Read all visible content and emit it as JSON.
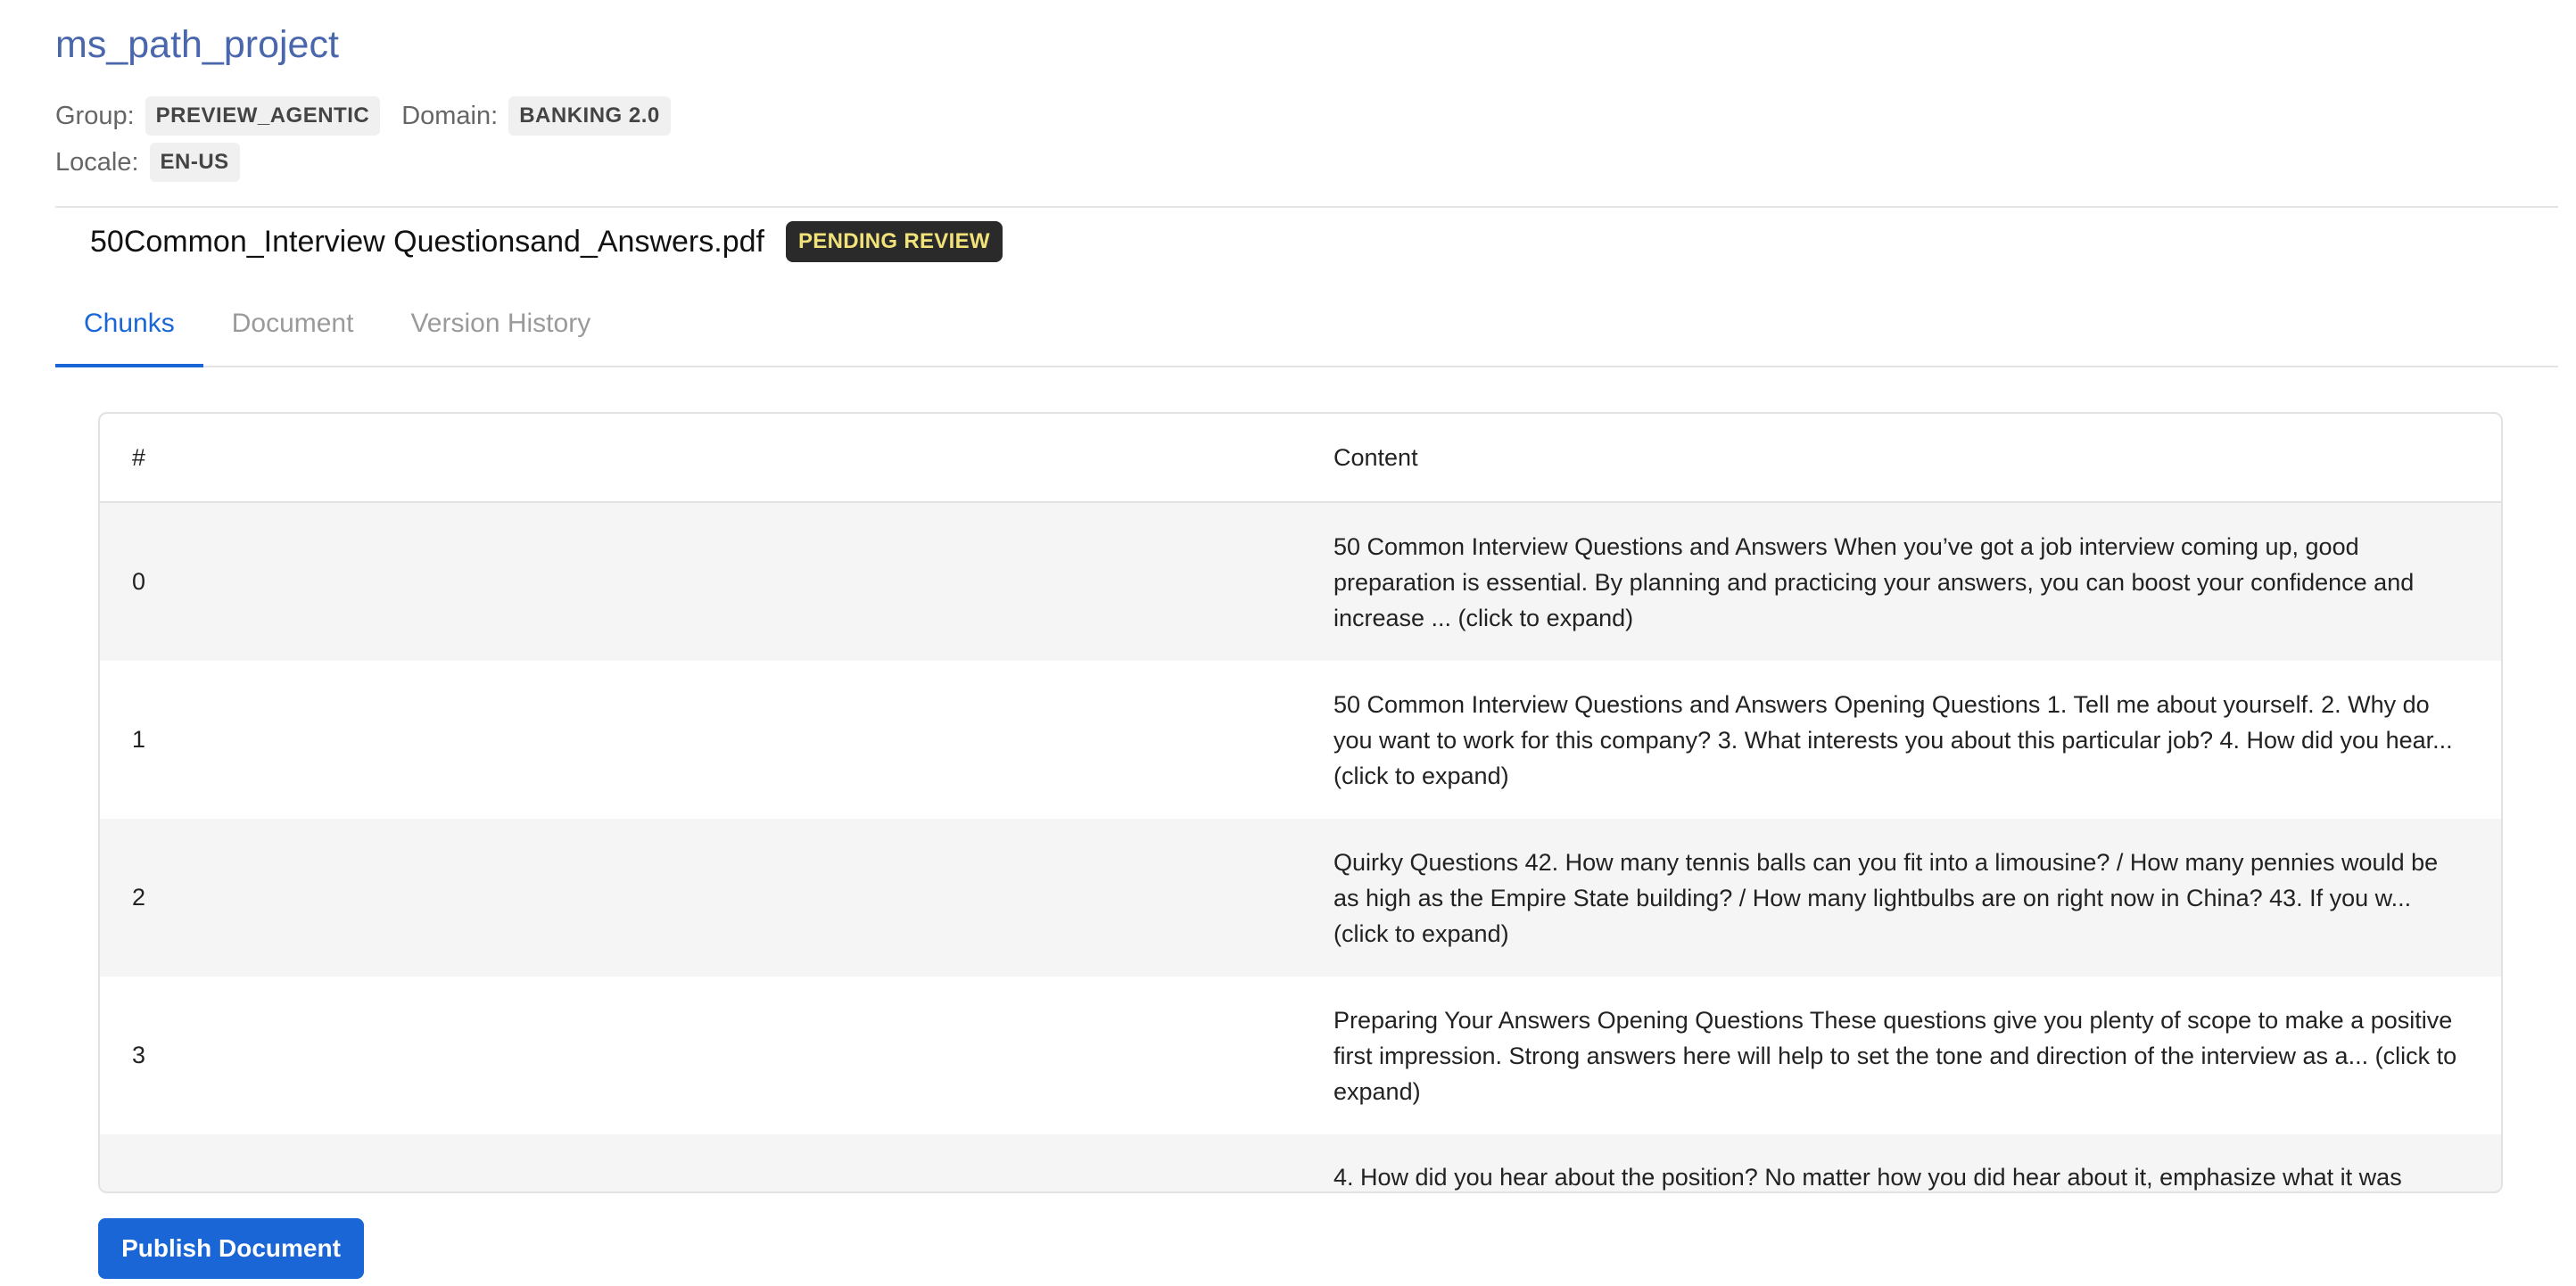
{
  "project": {
    "title": "ms_path_project"
  },
  "meta": {
    "group_label": "Group:",
    "group_value": "PREVIEW_AGENTIC",
    "domain_label": "Domain:",
    "domain_value": "BANKING 2.0",
    "locale_label": "Locale:",
    "locale_value": "EN-US"
  },
  "document": {
    "filename": "50Common_Interview Questionsand_Answers.pdf",
    "status": "PENDING REVIEW",
    "status_colors": {
      "background": "#2a2a2a",
      "text": "#f1e27a"
    }
  },
  "tabs": [
    {
      "label": "Chunks",
      "active": true
    },
    {
      "label": "Document",
      "active": false
    },
    {
      "label": "Version History",
      "active": false
    }
  ],
  "table": {
    "headers": {
      "num": "#",
      "content": "Content"
    },
    "rows": [
      {
        "num": "0",
        "content": "50 Common Interview Questions and Answers When you’ve got a job interview coming up, good preparation is essential. By planning and practicing your answers, you can boost your confidence and increase ... (click to expand)"
      },
      {
        "num": "1",
        "content": "50 Common Interview Questions and Answers Opening Questions 1. Tell me about yourself. 2. Why do you want to work for this company? 3. What interests you about this particular job? 4. How did you hear... (click to expand)"
      },
      {
        "num": "2",
        "content": "Quirky Questions 42. How many tennis balls can you fit into a limousine? / How many pennies would be as high as the Empire State building? / How many lightbulbs are on right now in China? 43. If you w... (click to expand)"
      },
      {
        "num": "3",
        "content": "Preparing Your Answers Opening Questions These questions give you plenty of scope to make a positive first impression. Strong answers here will help to set the tone and direction of the interview as a... (click to expand)"
      },
      {
        "num": "",
        "content": "4. How did you hear about the position? No matter how you did hear about it, emphasize what it was"
      }
    ]
  },
  "actions": {
    "publish_label": "Publish Document"
  },
  "colors": {
    "accent": "#1a66d6",
    "project_title": "#4a67ad"
  }
}
